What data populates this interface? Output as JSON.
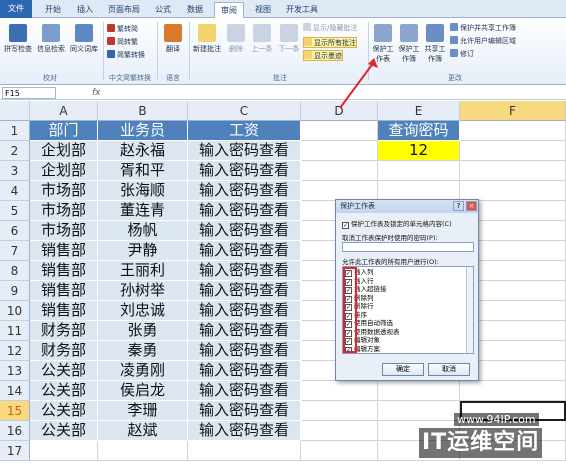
{
  "tabs": [
    "文件",
    "开始",
    "插入",
    "页面布局",
    "公式",
    "数据",
    "审阅",
    "视图",
    "开发工具"
  ],
  "ribbon": {
    "proofing": {
      "spell": "拼写检查",
      "info": "信息检索",
      "thes": "同义词库",
      "group": "校对"
    },
    "chinese": {
      "to_simp": "繁转简",
      "to_trad": "简转繁",
      "convert": "简繁转换",
      "group": "中文简繁转换"
    },
    "language": {
      "translate": "翻译",
      "group": "语言"
    },
    "comments": {
      "new": "新建批注",
      "delete": "删除",
      "prev": "上一条",
      "next": "下一条",
      "show_hide": "显示/隐藏批注",
      "show_all": "显示所有批注",
      "show_ink": "显示墨迹",
      "group": "批注"
    },
    "changes": {
      "protect_sheet": "保护工作表",
      "protect_book": "保护工作簿",
      "share_book": "共享工作簿",
      "protect_share": "保护并共享工作簿",
      "allow_edit": "允许用户编辑区域",
      "track": "修订",
      "group": "更改"
    }
  },
  "formula_bar": {
    "name_box": "F15",
    "fx": "fx",
    "value": ""
  },
  "columns": [
    "A",
    "B",
    "C",
    "D",
    "E",
    "F"
  ],
  "rows": [
    "1",
    "2",
    "3",
    "4",
    "5",
    "6",
    "7",
    "8",
    "9",
    "10",
    "11",
    "12",
    "13",
    "14",
    "15",
    "16",
    "17"
  ],
  "table": {
    "headers": [
      "部门",
      "业务员",
      "工资"
    ],
    "rows": [
      [
        "企划部",
        "赵永福",
        "输入密码查看"
      ],
      [
        "企划部",
        "胥和平",
        "输入密码查看"
      ],
      [
        "市场部",
        "张海顺",
        "输入密码查看"
      ],
      [
        "市场部",
        "董连青",
        "输入密码查看"
      ],
      [
        "市场部",
        "杨帆",
        "输入密码查看"
      ],
      [
        "销售部",
        "尹静",
        "输入密码查看"
      ],
      [
        "销售部",
        "王丽利",
        "输入密码查看"
      ],
      [
        "销售部",
        "孙树举",
        "输入密码查看"
      ],
      [
        "销售部",
        "刘忠诚",
        "输入密码查看"
      ],
      [
        "财务部",
        "张勇",
        "输入密码查看"
      ],
      [
        "财务部",
        "秦勇",
        "输入密码查看"
      ],
      [
        "公关部",
        "凌勇刚",
        "输入密码查看"
      ],
      [
        "公关部",
        "侯启龙",
        "输入密码查看"
      ],
      [
        "公关部",
        "李珊",
        "输入密码查看"
      ],
      [
        "公关部",
        "赵斌",
        "输入密码查看"
      ]
    ]
  },
  "query": {
    "label": "查询密码",
    "value": "12"
  },
  "dialog": {
    "title": "保护工作表",
    "help": "?",
    "close": "×",
    "protect_check": "保护工作表及锁定的单元格内容(C)",
    "password_label": "取消工作表保护时使用的密码(P):",
    "allow_label": "允许此工作表的所有用户进行(O):",
    "permissions": [
      "插入列",
      "插入行",
      "插入超链接",
      "删除列",
      "删除行",
      "排序",
      "使用自动筛选",
      "使用数据透视表",
      "编辑对象",
      "编辑方案"
    ],
    "ok": "确定",
    "cancel": "取消"
  },
  "watermark": {
    "url": "www.94IP.com",
    "brand": "IT运维空间"
  },
  "colors": {
    "header_fill": "#4f81bd",
    "body_fill": "#dce6f1",
    "highlight": "#ffff00",
    "selected": "#f9d97d",
    "annotation": "#e3242b"
  }
}
